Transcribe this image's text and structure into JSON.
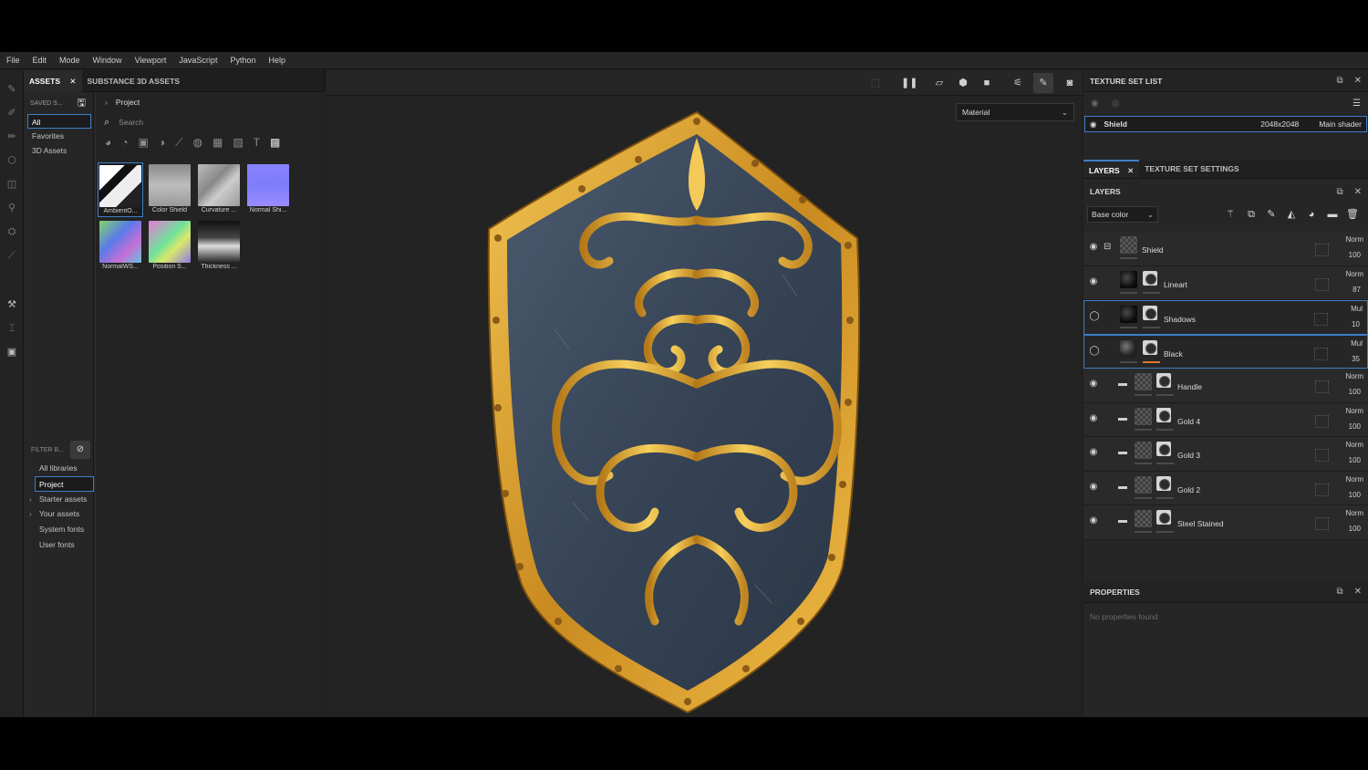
{
  "menu": [
    "File",
    "Edit",
    "Mode",
    "Window",
    "Viewport",
    "JavaScript",
    "Python",
    "Help"
  ],
  "assets": {
    "tabs": [
      "ASSETS",
      "SUBSTANCE 3D ASSETS"
    ],
    "saved_label": "SAVED S...",
    "categories": [
      "All",
      "Favorites",
      "3D Assets"
    ],
    "filter_label": "FILTER B...",
    "libraries": [
      "All libraries",
      "Project",
      "Starter assets",
      "Your assets",
      "System fonts",
      "User fonts"
    ],
    "breadcrumb": "Project",
    "search_placeholder": "Search",
    "thumbnails": [
      {
        "label": "AmbientO..."
      },
      {
        "label": "Color Shield"
      },
      {
        "label": "Curvature ..."
      },
      {
        "label": "Normal Shi..."
      },
      {
        "label": "NormalWS..."
      },
      {
        "label": "Position S..."
      },
      {
        "label": "Thickness ..."
      }
    ]
  },
  "viewport": {
    "material_select": "Material"
  },
  "texture_set_list": {
    "title": "TEXTURE SET LIST",
    "row": {
      "name": "Shield",
      "resolution": "2048x2048",
      "shader": "Main shader"
    }
  },
  "layers_panel": {
    "tabs": [
      "LAYERS",
      "TEXTURE SET SETTINGS"
    ],
    "title": "LAYERS",
    "channel": "Base color",
    "layers": [
      {
        "name": "Shield",
        "blend": "Norm",
        "opacity": "100"
      },
      {
        "name": "Lineart",
        "blend": "Norm",
        "opacity": "87"
      },
      {
        "name": "Shadows",
        "blend": "Mul",
        "opacity": "10"
      },
      {
        "name": "Black",
        "blend": "Mul",
        "opacity": "35"
      },
      {
        "name": "Handle",
        "blend": "Norm",
        "opacity": "100"
      },
      {
        "name": "Gold 4",
        "blend": "Norm",
        "opacity": "100"
      },
      {
        "name": "Gold 3",
        "blend": "Norm",
        "opacity": "100"
      },
      {
        "name": "Gold 2",
        "blend": "Norm",
        "opacity": "100"
      },
      {
        "name": "Steel Stained",
        "blend": "Norm",
        "opacity": "100"
      }
    ]
  },
  "properties": {
    "title": "PROPERTIES",
    "empty": "No properties found"
  },
  "colors": {
    "accent": "#3c7fc8",
    "gold": "#d9a12c",
    "steel": "#3b4a5e",
    "mask_bar": "#e0772e"
  }
}
